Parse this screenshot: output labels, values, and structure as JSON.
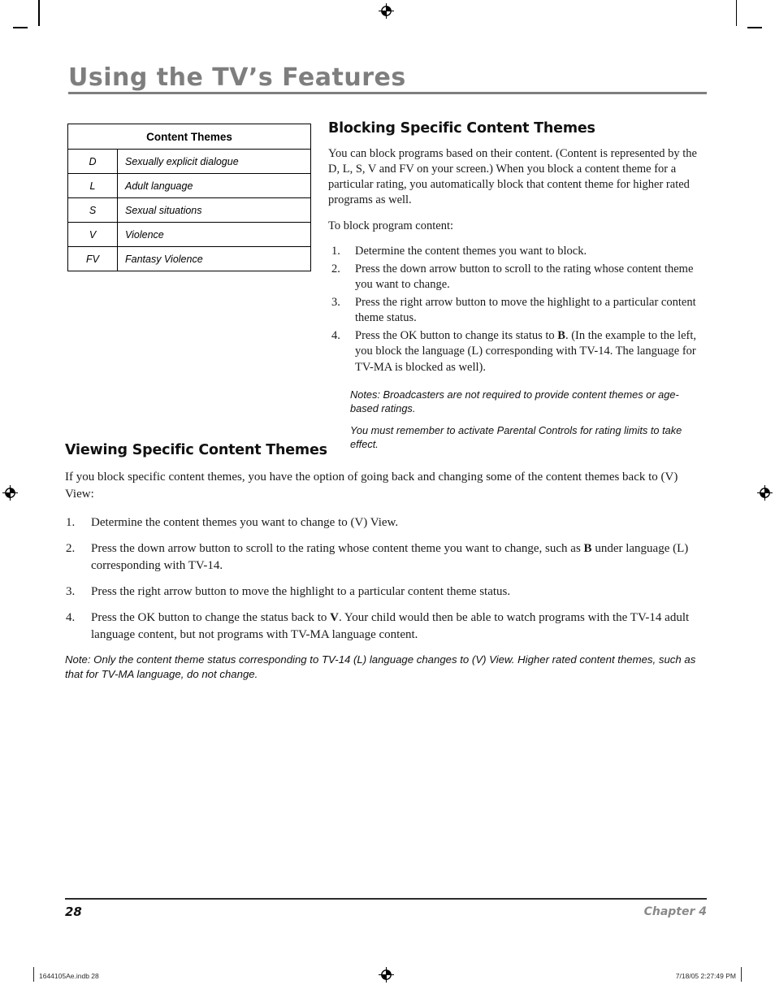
{
  "page": {
    "title": "Using the TV’s Features",
    "number": "28",
    "chapter": "Chapter 4"
  },
  "table": {
    "caption": "Content Themes",
    "rows": [
      {
        "abbr": "D",
        "desc": "Sexually explicit dialogue"
      },
      {
        "abbr": "L",
        "desc": "Adult language"
      },
      {
        "abbr": "S",
        "desc": "Sexual situations"
      },
      {
        "abbr": "V",
        "desc": "Violence"
      },
      {
        "abbr": "FV",
        "desc": "Fantasy Violence"
      }
    ]
  },
  "blocking_section": {
    "heading": "Blocking Specific Content Themes",
    "intro": "You can block programs based on their content. (Content is represented by the D, L, S, V and FV on your screen.) When you block a content theme for a particular rating, you automatically block that content theme for higher rated programs as well.",
    "lead_in": "To block program content:",
    "steps": [
      "Determine the content themes you want to block.",
      "Press the down arrow button to scroll to the rating whose content theme you want to change.",
      "Press the right arrow button to move the highlight to a particular content theme status.",
      "Press the OK button to change its status to B. (In the example to the left, you block the language (L) corresponding with TV-14. The language for TV-MA is blocked as well)."
    ],
    "step4_parts": {
      "before": "Press the OK button to change its status to ",
      "bold": "B",
      "after": ". (In the example to the left, you block the language (L) corresponding with TV-14. The language for TV-MA is blocked as well)."
    },
    "notes": [
      "Notes: Broadcasters are not required to provide content themes or age-based ratings.",
      "You must remember to activate Parental Controls for rating limits to take effect."
    ]
  },
  "viewing_section": {
    "heading": "Viewing Specific Content Themes",
    "intro": "If you block specific content themes, you have the option of going back and changing some of the content themes back to (V) View:",
    "steps": [
      "Determine the content themes you want to change to (V) View.",
      "Press the down arrow button to scroll to the rating whose content theme you want to change, such as B under language (L) corresponding with TV-14.",
      "Press the right arrow button to move the highlight to a particular content theme status.",
      "Press the OK button to change the status back to V. Your child would then be able to watch programs with the TV-14 adult language content, but not programs with TV-MA language content."
    ],
    "step2_parts": {
      "before": "Press the down arrow button to scroll to the rating whose content theme you want to change, such as ",
      "bold": "B",
      "after": " under language (L) corresponding with TV-14."
    },
    "step4_parts": {
      "before": "Press the OK button to change the status back to ",
      "bold": "V",
      "after": ". Your child would then be able to watch programs with the TV-14 adult language content, but not programs with TV-MA language content."
    },
    "note": "Note:  Only the content theme status corresponding to TV-14  (L) language changes to (V) View. Higher rated content themes, such as that for TV-MA language, do not change."
  },
  "print_slug": {
    "left": "1644105Ae.indb   28",
    "right": "7/18/05   2:27:49 PM"
  },
  "colors": {
    "title_grey": "#7e7e7e",
    "chapter_grey": "#8a8a8a",
    "text_black": "#1a1a1a"
  }
}
